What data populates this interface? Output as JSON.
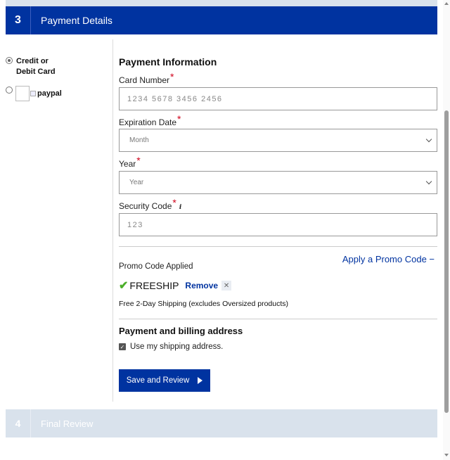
{
  "step3": {
    "number": "3",
    "title": "Payment Details"
  },
  "step4": {
    "number": "4",
    "title": "Final Review"
  },
  "payment_methods": [
    {
      "label_line1": "Credit or",
      "label_line2": "Debit Card",
      "selected": true
    },
    {
      "image_alt": "paypal",
      "selected": false
    }
  ],
  "payment_info": {
    "heading": "Payment Information",
    "card_number": {
      "label": "Card Number",
      "required_mark": "*",
      "placeholder": "1234 5678 3456 2456"
    },
    "expiration": {
      "label": "Expiration Date",
      "required_mark": "*",
      "selected": "Month"
    },
    "year": {
      "label": "Year",
      "required_mark": "*",
      "selected": "Year"
    },
    "security_code": {
      "label": "Security Code",
      "required_mark": "*",
      "info_icon": "i",
      "placeholder": "123"
    }
  },
  "promo": {
    "apply_link": "Apply a Promo Code −",
    "applied_label": "Promo Code Applied",
    "code": "FREESHIP",
    "remove_label": "Remove",
    "close_glyph": "✕",
    "description": "Free 2-Day Shipping (excludes Oversized products)"
  },
  "billing": {
    "heading": "Payment and billing address",
    "use_shipping_label": "Use my shipping address.",
    "use_shipping_checked": true
  },
  "save_button": {
    "label": "Save and Review"
  },
  "colors": {
    "brand_blue": "#0033a0",
    "required_red": "#d0021b",
    "check_green": "#4caf2a",
    "disabled_step": "#d9e2ec"
  }
}
